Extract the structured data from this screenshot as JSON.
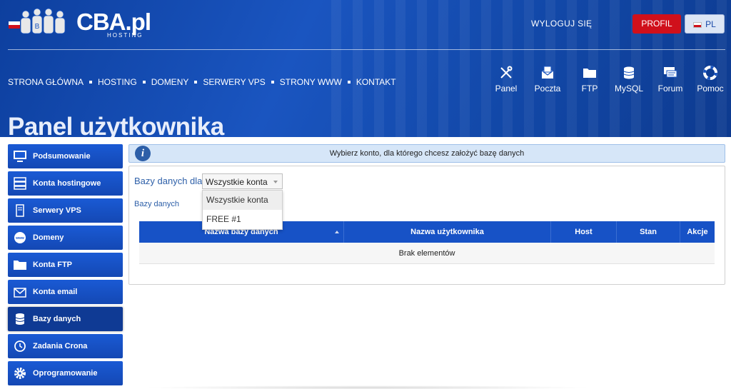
{
  "header": {
    "logo_text": "CBA.pl",
    "logo_sub": "HOSTING",
    "logout_label": "WYLOGUJ SIĘ",
    "profile_label": "PROFIL",
    "lang_label": "PL"
  },
  "topnav": [
    "STRONA GŁÓWNA",
    "HOSTING",
    "DOMENY",
    "SERWERY VPS",
    "STRONY WWW",
    "KONTAKT"
  ],
  "iconbar": [
    {
      "label": "Panel",
      "icon": "tools-icon"
    },
    {
      "label": "Poczta",
      "icon": "mail-icon"
    },
    {
      "label": "FTP",
      "icon": "folder-icon"
    },
    {
      "label": "MySQL",
      "icon": "database-icon"
    },
    {
      "label": "Forum",
      "icon": "chat-icon"
    },
    {
      "label": "Pomoc",
      "icon": "lifebuoy-icon"
    }
  ],
  "page_title": "Panel użytkownika",
  "sidebar": [
    {
      "label": "Podsumowanie",
      "icon": "monitor-icon"
    },
    {
      "label": "Konta hostingowe",
      "icon": "server-icon"
    },
    {
      "label": "Serwery VPS",
      "icon": "vps-icon"
    },
    {
      "label": "Domeny",
      "icon": "globe-icon"
    },
    {
      "label": "Konta FTP",
      "icon": "folder-icon"
    },
    {
      "label": "Konta email",
      "icon": "envelope-icon"
    },
    {
      "label": "Bazy danych",
      "icon": "database-icon",
      "active": true
    },
    {
      "label": "Zadania Crona",
      "icon": "clock-icon"
    },
    {
      "label": "Oprogramowanie",
      "icon": "gear-icon"
    }
  ],
  "info": {
    "message": "Wybierz konto, dla którego chcesz założyć bazę danych"
  },
  "content": {
    "databases_for_label": "Bazy danych dla",
    "select_value": "Wszystkie konta",
    "options": [
      "Wszystkie konta",
      "FREE #1"
    ],
    "databases_label": "Bazy danych",
    "table": {
      "columns": [
        "Nazwa bazy danych",
        "Nazwa użytkownika",
        "Host",
        "Stan",
        "Akcje"
      ],
      "empty_text": "Brak elementów"
    }
  },
  "colors": {
    "header": "#1a55c0",
    "sidebar": "#1a5ad4",
    "profile": "#d0101b",
    "table_header": "#1752c6"
  }
}
